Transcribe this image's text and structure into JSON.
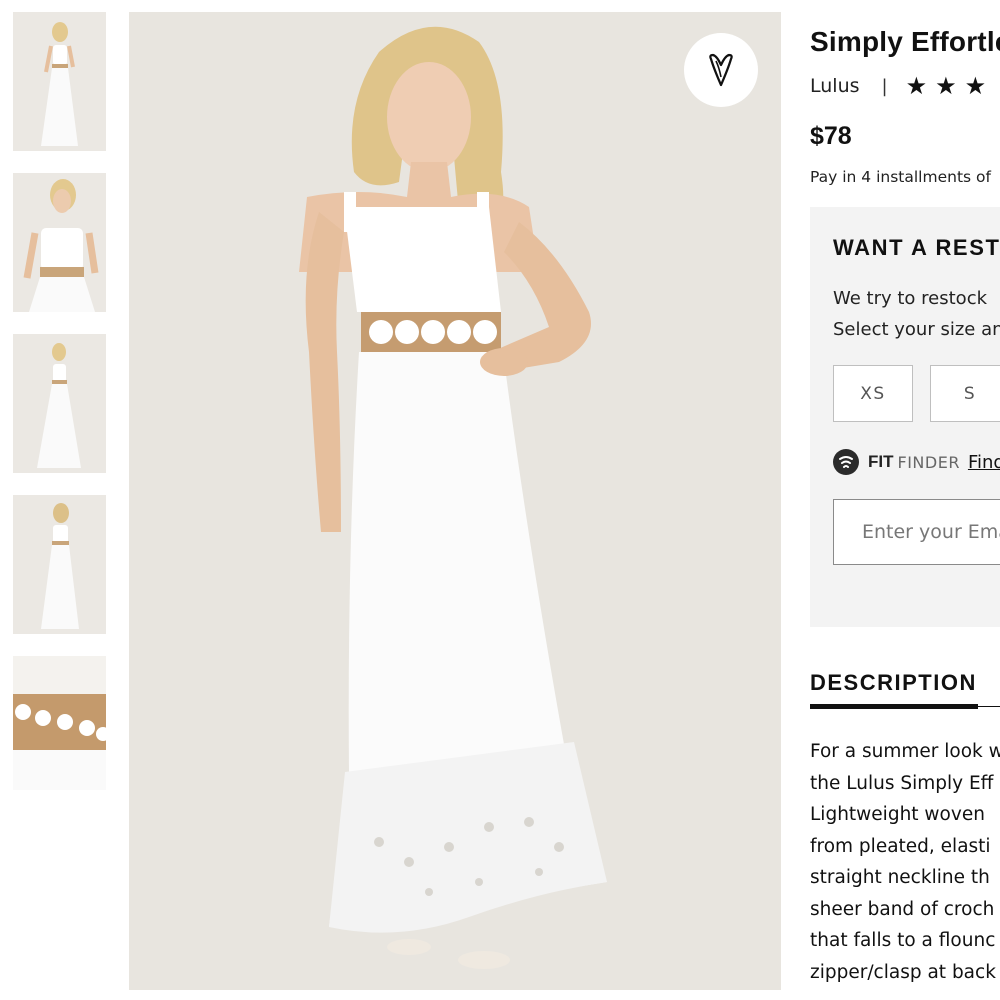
{
  "product": {
    "title": "Simply Effortless",
    "brand": "Lulus",
    "separator": "|",
    "stars": [
      "★",
      "★",
      "★"
    ],
    "price": "$78",
    "installments": "Pay in 4 installments of"
  },
  "gallery": {
    "thumbnail_count": 5,
    "wishlist_icon": "heart-icon"
  },
  "restock": {
    "heading": "WANT A RESTOCK",
    "line1": "We try to restock",
    "line2": "Select your size and",
    "sizes": [
      "XS",
      "S"
    ],
    "fit_finder": {
      "bold": "FIT",
      "light": "FINDER",
      "link": "Find"
    },
    "email_placeholder": "Enter your Email"
  },
  "description": {
    "heading": "DESCRIPTION",
    "lines": [
      "For a summer look w",
      "the Lulus Simply Eff",
      "Lightweight woven",
      "from pleated, elasti",
      "straight neckline th",
      "sheer band of croch",
      "that falls to a flounc",
      "zipper/clasp at back"
    ]
  },
  "colors": {
    "photo_background": "#e8e5df",
    "panel_background": "#f3f3f3",
    "text": "#111111"
  }
}
